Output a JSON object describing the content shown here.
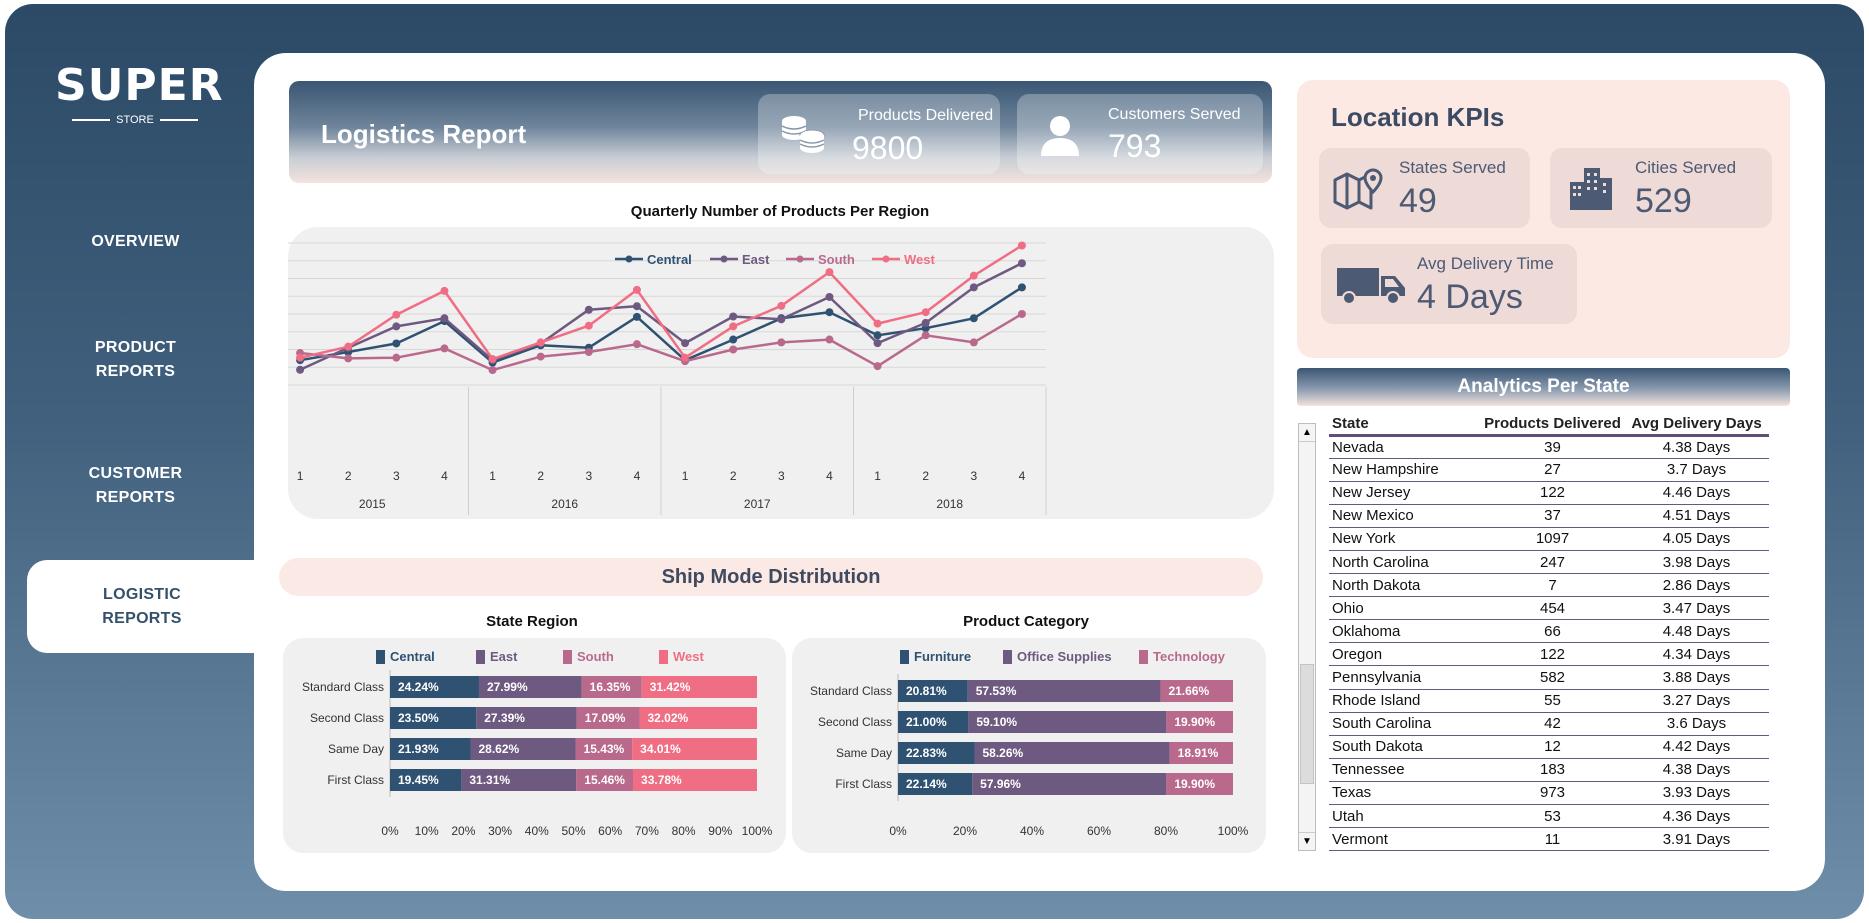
{
  "brand": {
    "logo_text": "SUPER",
    "logo_sub": "STORE"
  },
  "nav": [
    {
      "line1": "OVERVIEW",
      "line2": ""
    },
    {
      "line1": "PRODUCT",
      "line2": "REPORTS"
    },
    {
      "line1": "CUSTOMER",
      "line2": "REPORTS"
    },
    {
      "line1": "LOGISTIC",
      "line2": "REPORTS"
    }
  ],
  "header": {
    "title": "Logistics Report",
    "products_label": "Products Delivered",
    "products_value": "9800",
    "customers_label": "Customers Served",
    "customers_value": "793"
  },
  "colors": {
    "central": "#2f5273",
    "east": "#6e5a80",
    "south": "#b96a8c",
    "west": "#f06e84"
  },
  "line_chart": {
    "title": "Quarterly Number of Products Per Region",
    "chart_data": {
      "type": "line",
      "categories": [
        "1",
        "2",
        "3",
        "4",
        "1",
        "2",
        "3",
        "4",
        "1",
        "2",
        "3",
        "4",
        "1",
        "2",
        "3",
        "4"
      ],
      "groups": [
        "2015",
        "2016",
        "2017",
        "2018"
      ],
      "ylim": [
        0,
        400
      ],
      "yticks": [
        "0",
        "50",
        "100",
        "150",
        "200",
        "250",
        "300",
        "350",
        "400"
      ],
      "series": [
        {
          "name": "Central",
          "values": [
            70,
            93,
            117,
            180,
            63,
            112,
            105,
            192,
            70,
            128,
            188,
            205,
            140,
            160,
            188,
            275
          ]
        },
        {
          "name": "East",
          "values": [
            43,
            105,
            165,
            188,
            70,
            117,
            212,
            222,
            118,
            193,
            185,
            248,
            118,
            175,
            275,
            343
          ]
        },
        {
          "name": "South",
          "values": [
            90,
            75,
            77,
            103,
            42,
            80,
            93,
            115,
            67,
            100,
            120,
            128,
            53,
            140,
            120,
            200
          ]
        },
        {
          "name": "West",
          "values": [
            77,
            108,
            198,
            265,
            73,
            120,
            167,
            268,
            77,
            165,
            223,
            318,
            173,
            205,
            308,
            393
          ]
        }
      ]
    }
  },
  "ship": {
    "banner": "Ship Mode Distribution",
    "region_title": "State Region",
    "category_title": "Product Category",
    "chart_data": [
      {
        "type": "bar",
        "categories": [
          "Standard Class",
          "Second Class",
          "Same Day",
          "First Class"
        ],
        "series": [
          {
            "name": "Central",
            "values": [
              24.24,
              23.5,
              21.93,
              19.45
            ],
            "labels": [
              "24.24%",
              "23.50%",
              "21.93%",
              "19.45%"
            ]
          },
          {
            "name": "East",
            "values": [
              27.99,
              27.39,
              28.62,
              31.31
            ],
            "labels": [
              "27.99%",
              "27.39%",
              "28.62%",
              "31.31%"
            ]
          },
          {
            "name": "South",
            "values": [
              16.35,
              17.09,
              15.43,
              15.46
            ],
            "labels": [
              "16.35%",
              "17.09%",
              "15.43%",
              "15.46%"
            ]
          },
          {
            "name": "West",
            "values": [
              31.42,
              32.02,
              34.01,
              33.78
            ],
            "labels": [
              "31.42%",
              "32.02%",
              "34.01%",
              "33.78%"
            ]
          }
        ],
        "xticks": [
          "0%",
          "10%",
          "20%",
          "30%",
          "40%",
          "50%",
          "60%",
          "70%",
          "80%",
          "90%",
          "100%"
        ]
      },
      {
        "type": "bar",
        "categories": [
          "Standard Class",
          "Second Class",
          "Same Day",
          "First Class"
        ],
        "series": [
          {
            "name": "Furniture",
            "values": [
              20.81,
              21.0,
              22.83,
              22.14
            ],
            "labels": [
              "20.81%",
              "21.00%",
              "22.83%",
              "22.14%"
            ]
          },
          {
            "name": "Office Supplies",
            "values": [
              57.53,
              59.1,
              58.26,
              57.96
            ],
            "labels": [
              "57.53%",
              "59.10%",
              "58.26%",
              "57.96%"
            ]
          },
          {
            "name": "Technology",
            "values": [
              21.66,
              19.9,
              18.91,
              19.9
            ],
            "labels": [
              "21.66%",
              "19.90%",
              "18.91%",
              "19.90%"
            ]
          }
        ],
        "xticks": [
          "0%",
          "20%",
          "40%",
          "60%",
          "80%",
          "100%"
        ]
      }
    ]
  },
  "location": {
    "title": "Location KPIs",
    "states_label": "States Served",
    "states_value": "49",
    "cities_label": "Cities Served",
    "cities_value": "529",
    "delivery_label": "Avg Delivery Time",
    "delivery_value": "4 Days"
  },
  "state_table": {
    "banner": "Analytics Per State",
    "headers": [
      "State",
      "Products Delivered",
      "Avg Delivery Days"
    ],
    "rows": [
      [
        "Nevada",
        "39",
        "4.38 Days"
      ],
      [
        "New Hampshire",
        "27",
        "3.7 Days"
      ],
      [
        "New Jersey",
        "122",
        "4.46 Days"
      ],
      [
        "New Mexico",
        "37",
        "4.51 Days"
      ],
      [
        "New York",
        "1097",
        "4.05 Days"
      ],
      [
        "North Carolina",
        "247",
        "3.98 Days"
      ],
      [
        "North Dakota",
        "7",
        "2.86 Days"
      ],
      [
        "Ohio",
        "454",
        "3.47 Days"
      ],
      [
        "Oklahoma",
        "66",
        "4.48 Days"
      ],
      [
        "Oregon",
        "122",
        "4.34 Days"
      ],
      [
        "Pennsylvania",
        "582",
        "3.88 Days"
      ],
      [
        "Rhode Island",
        "55",
        "3.27 Days"
      ],
      [
        "South Carolina",
        "42",
        "3.6 Days"
      ],
      [
        "South Dakota",
        "12",
        "4.42 Days"
      ],
      [
        "Tennessee",
        "183",
        "4.38 Days"
      ],
      [
        "Texas",
        "973",
        "3.93 Days"
      ],
      [
        "Utah",
        "53",
        "4.36 Days"
      ],
      [
        "Vermont",
        "11",
        "3.91 Days"
      ]
    ]
  }
}
